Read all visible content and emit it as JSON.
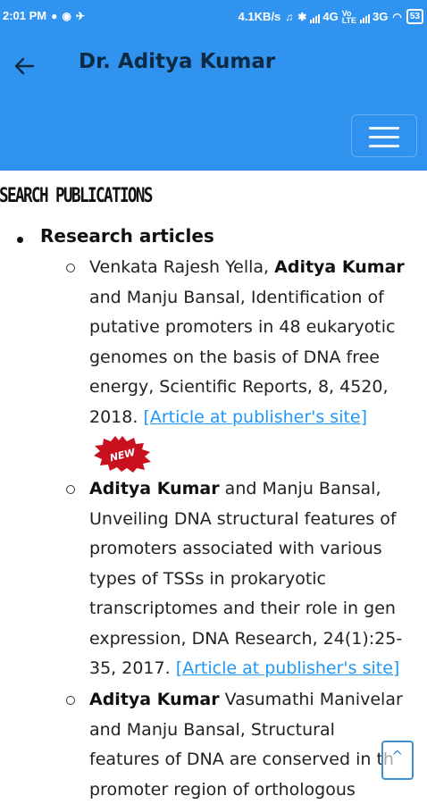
{
  "status_bar": {
    "time": "2:01 PM",
    "speed": "4.1KB/s",
    "net1": "4G",
    "net2": "3G",
    "battery": "53"
  },
  "app_bar": {
    "title": "Dr. Aditya Kumar"
  },
  "content": {
    "section_heading": "ESEARCH PUBLICATIONS",
    "list_label": "Research articles",
    "new_badge": "NEW",
    "publications": [
      {
        "lines": [
          {
            "pre": "Venkata Rajesh Yella, ",
            "bold": "Aditya Kumar",
            "post": ""
          },
          {
            "pre": "and Manju Bansal, Identification of",
            "bold": "",
            "post": ""
          },
          {
            "pre": "putative promoters in 48 eukaryotic",
            "bold": "",
            "post": ""
          },
          {
            "pre": "genomes on the basis of DNA free",
            "bold": "",
            "post": ""
          },
          {
            "pre": "energy, Scientific Reports, 8, 4520,",
            "bold": "",
            "post": ""
          },
          {
            "pre": "2018. ",
            "bold": "",
            "post": "",
            "link": "[Article at publisher's site]"
          }
        ]
      },
      {
        "lines": [
          {
            "pre": "",
            "bold": "Aditya Kumar",
            "post": " and Manju Bansal,"
          },
          {
            "pre": "Unveiling DNA structural features of",
            "bold": "",
            "post": ""
          },
          {
            "pre": "promoters associated with various",
            "bold": "",
            "post": ""
          },
          {
            "pre": "types of TSSs in prokaryotic",
            "bold": "",
            "post": ""
          },
          {
            "pre": "transcriptomes and their role in gen",
            "bold": "",
            "post": ""
          },
          {
            "pre": "expression, DNA Research, 24(1):25-",
            "bold": "",
            "post": ""
          },
          {
            "pre": "35, 2017. ",
            "bold": "",
            "post": "",
            "link": "[Article at publisher's site]"
          }
        ]
      },
      {
        "lines": [
          {
            "pre": "",
            "bold": "Aditya Kumar",
            "post": " Vasumathi Manivelar"
          },
          {
            "pre": "and Manju Bansal, Structural",
            "bold": "",
            "post": ""
          },
          {
            "pre": "features of DNA are conserved in th",
            "bold": "",
            "post": ""
          },
          {
            "pre": "promoter region of orthologous",
            "bold": "",
            "post": ""
          }
        ]
      }
    ]
  },
  "colors": {
    "primary": "#2f93ef",
    "title_text": "#0c2a44",
    "link": "#2196f3",
    "badge": "#c8101e"
  }
}
